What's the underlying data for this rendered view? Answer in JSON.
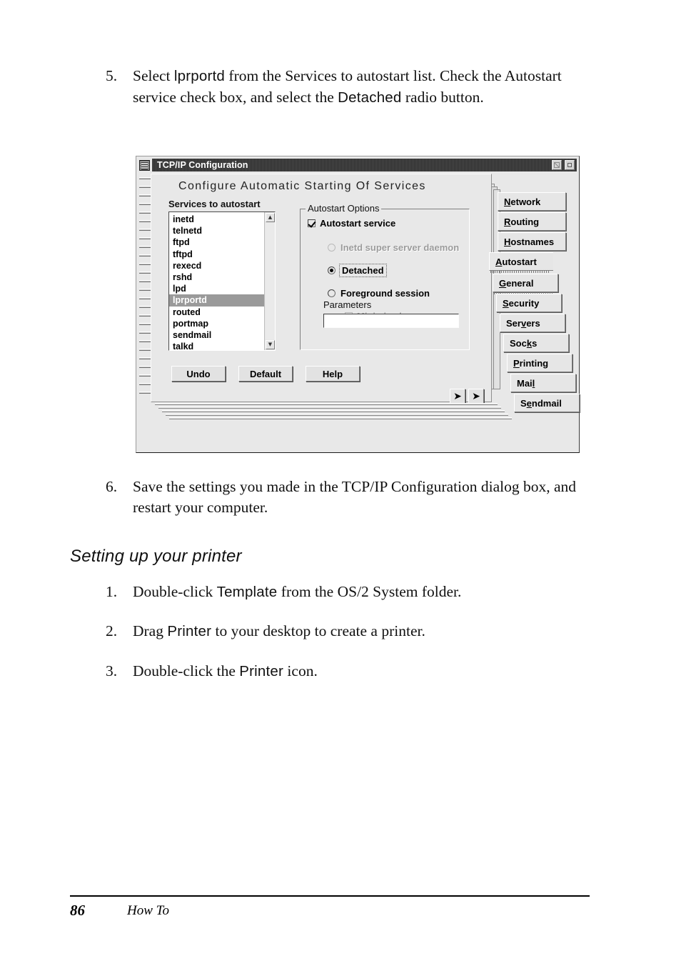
{
  "page": {
    "footer_page_number": "86",
    "footer_label": "How To",
    "section_heading": "Setting up your printer",
    "steps_before": [
      {
        "number": "5.",
        "parts": [
          {
            "t": "Select ",
            "ui": false
          },
          {
            "t": "lprportd",
            "ui": true
          },
          {
            "t": " from the Services to autostart list. Check the Autostart service check box, and select the ",
            "ui": false
          },
          {
            "t": "Detached",
            "ui": true
          },
          {
            "t": " radio button.",
            "ui": false
          }
        ],
        "plain": "Select lprportd from the Services to autostart list. Check the Autostart service check box, and select the Detached radio button."
      },
      {
        "number": "6.",
        "plain": "Save the settings you made in the TCP/IP Configuration dialog box, and restart your computer."
      }
    ],
    "steps_after": [
      {
        "number": "1.",
        "plain": "Double-click Template from the OS/2 System folder."
      },
      {
        "number": "2.",
        "plain": "Drag Printer to your desktop to create a printer."
      },
      {
        "number": "3.",
        "plain": "Double-click the Printer icon."
      }
    ]
  },
  "dialog": {
    "title": "TCP/IP Configuration",
    "title_icon": "notebook-icon",
    "restore_button": "restore-icon",
    "minimize_button": "minimize-icon",
    "notebook_heading": "Configure  Automatic  Starting  Of  Services",
    "services_list_label": "Services to autostart",
    "services": [
      "inetd",
      "telnetd",
      "ftpd",
      "tftpd",
      "rexecd",
      "rshd",
      "lpd",
      "lprportd",
      "routed",
      "portmap",
      "sendmail",
      "talkd"
    ],
    "selected_service": "lprportd",
    "scroll_up_glyph": "▲",
    "scroll_down_glyph": "▼",
    "autostart_group": {
      "legend": "Autostart Options",
      "autostart_service": {
        "label": "Autostart service",
        "checked": true,
        "enabled": true
      },
      "radios": [
        {
          "label": "Inetd super server daemon",
          "selected": false,
          "enabled": false
        },
        {
          "label": "Detached",
          "selected": true,
          "enabled": true
        },
        {
          "label": "Foreground session",
          "selected": false,
          "enabled": true
        }
      ],
      "minimized": {
        "label": "Minimized",
        "checked": false,
        "enabled": false
      },
      "parameters_label": "Parameters",
      "parameters_value": "",
      "parameters_placeholder": ""
    },
    "buttons": [
      {
        "label": "Undo",
        "accel": "U"
      },
      {
        "label": "Default",
        "accel": "D"
      },
      {
        "label": "Help",
        "accel": ""
      }
    ],
    "nav_prev_glyph": "◆",
    "nav_next_glyph": "◆",
    "nav_prev_name": "previous-page",
    "nav_next_name": "next-page",
    "tabs": [
      {
        "label": "Network",
        "accel": "N",
        "selected": false
      },
      {
        "label": "Routing",
        "accel": "R",
        "selected": false
      },
      {
        "label": "Hostnames",
        "accel": "H",
        "selected": false
      },
      {
        "label": "Autostart",
        "accel": "A",
        "selected": true
      },
      {
        "label": "General",
        "accel": "G",
        "selected": false
      },
      {
        "label": "Security",
        "accel": "S",
        "selected": false
      },
      {
        "label": "Servers",
        "accel": "v",
        "selected": false
      },
      {
        "label": "Socks",
        "accel": "k",
        "selected": false
      },
      {
        "label": "Printing",
        "accel": "P",
        "selected": false
      },
      {
        "label": "Mail",
        "accel": "l",
        "selected": false
      },
      {
        "label": "Sendmail",
        "accel": "e",
        "selected": false
      }
    ]
  }
}
